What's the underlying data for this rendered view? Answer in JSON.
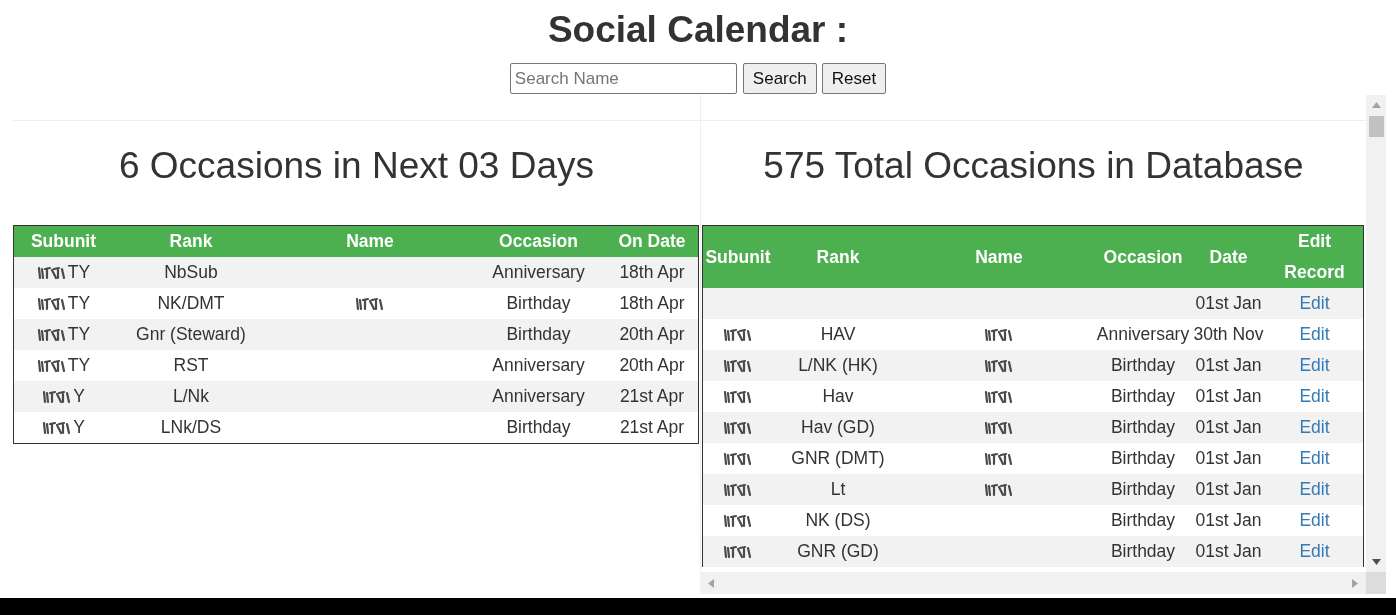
{
  "page": {
    "title": "Social Calendar :"
  },
  "search": {
    "placeholder": "Search Name",
    "buttons": [
      "Search",
      "Reset"
    ]
  },
  "upcoming": {
    "heading": "6 Occasions in Next 03 Days",
    "columns": [
      "Subunit",
      "Rank",
      "Name",
      "Occasion",
      "On Date"
    ],
    "rows": [
      {
        "subunit": {
          "text": "TY",
          "redacted": true
        },
        "rank": "NbSub",
        "name": {
          "redacted": false
        },
        "occasion": "Anniversary",
        "date": "18th Apr"
      },
      {
        "subunit": {
          "text": "TY",
          "redacted": true
        },
        "rank": "NK/DMT",
        "name": {
          "redacted": true
        },
        "occasion": "Birthday",
        "date": "18th Apr"
      },
      {
        "subunit": {
          "text": "TY",
          "redacted": true
        },
        "rank": "Gnr (Steward)",
        "name": {
          "redacted": false
        },
        "occasion": "Birthday",
        "date": "20th Apr"
      },
      {
        "subunit": {
          "text": "TY",
          "redacted": true
        },
        "rank": "RST",
        "name": {
          "redacted": false
        },
        "occasion": "Anniversary",
        "date": "20th Apr"
      },
      {
        "subunit": {
          "text": "Y",
          "redacted": true
        },
        "rank": "L/Nk",
        "name": {
          "redacted": false
        },
        "occasion": "Anniversary",
        "date": "21st Apr"
      },
      {
        "subunit": {
          "text": "Y",
          "redacted": true
        },
        "rank": "LNk/DS",
        "name": {
          "redacted": false
        },
        "occasion": "Birthday",
        "date": "21st Apr"
      }
    ]
  },
  "database": {
    "heading": "575 Total Occasions in Database",
    "columns": [
      "Subunit",
      "Rank",
      "Name",
      "Occasion",
      "Date",
      "Edit Record"
    ],
    "rows": [
      {
        "subunit": {
          "redacted": false
        },
        "name": {
          "redacted": false
        },
        "date": "01st Jan",
        "action": "Edit"
      },
      {
        "subunit": {
          "redacted": true
        },
        "rank": "HAV",
        "name": {
          "redacted": true
        },
        "occasion": "Anniversary",
        "date": "30th Nov",
        "action": "Edit"
      },
      {
        "subunit": {
          "redacted": true
        },
        "rank": "L/NK (HK)",
        "name": {
          "redacted": true
        },
        "occasion": "Birthday",
        "date": "01st Jan",
        "action": "Edit"
      },
      {
        "subunit": {
          "redacted": true
        },
        "rank": "Hav",
        "name": {
          "redacted": true
        },
        "occasion": "Birthday",
        "date": "01st Jan",
        "action": "Edit"
      },
      {
        "subunit": {
          "redacted": true
        },
        "rank": "Hav (GD)",
        "name": {
          "redacted": true
        },
        "occasion": "Birthday",
        "date": "01st Jan",
        "action": "Edit"
      },
      {
        "subunit": {
          "redacted": true
        },
        "rank": "GNR (DMT)",
        "name": {
          "redacted": true
        },
        "occasion": "Birthday",
        "date": "01st Jan",
        "action": "Edit"
      },
      {
        "subunit": {
          "redacted": true
        },
        "rank": "Lt",
        "name": {
          "redacted": true
        },
        "occasion": "Birthday",
        "date": "01st Jan",
        "action": "Edit"
      },
      {
        "subunit": {
          "redacted": true
        },
        "rank": "NK (DS)",
        "name": {
          "redacted": false
        },
        "occasion": "Birthday",
        "date": "01st Jan",
        "action": "Edit"
      },
      {
        "subunit": {
          "redacted": true
        },
        "rank": "GNR (GD)",
        "name": {
          "redacted": false
        },
        "occasion": "Birthday",
        "date": "01st Jan",
        "action": "Edit"
      }
    ]
  }
}
